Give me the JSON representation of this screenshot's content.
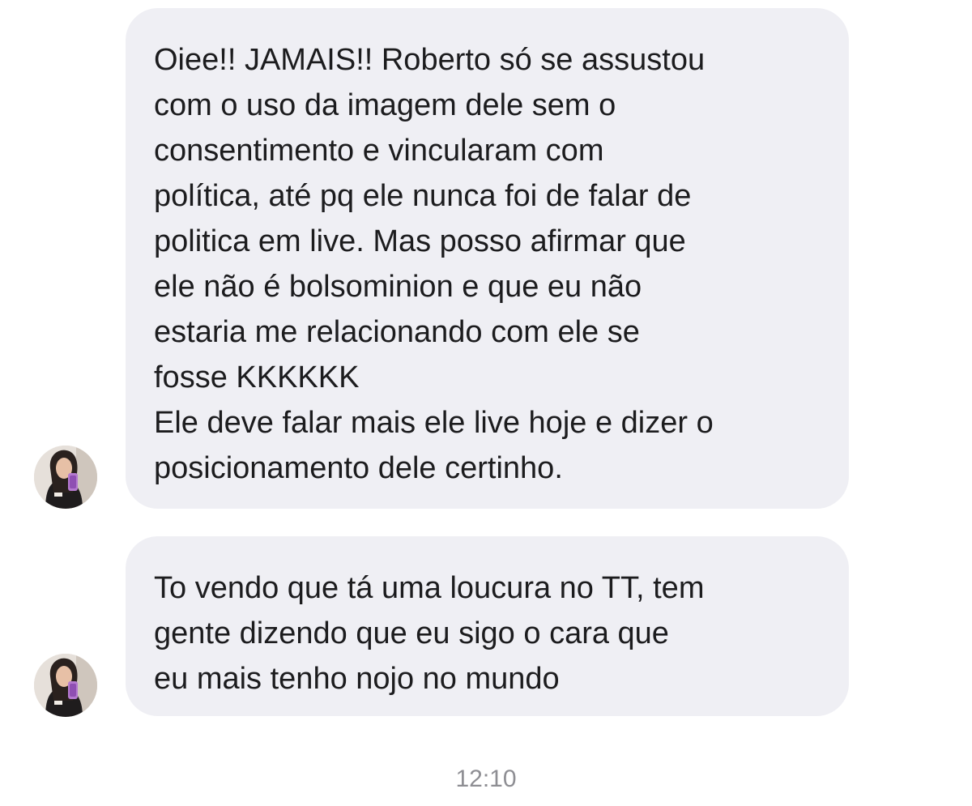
{
  "conversation": {
    "messages": [
      {
        "lines": [
          "Oiee!! JAMAIS!! Roberto só se assustou",
          "com o uso da imagem dele sem o",
          "consentimento e vincularam com",
          "política, até pq ele nunca foi de falar de",
          "politica em live. Mas posso afirmar que",
          "ele não é bolsominion e que eu não",
          "estaria me relacionando com ele se",
          "fosse KKKKKK",
          "Ele deve falar mais ele live hoje e dizer o",
          "posicionamento dele certinho."
        ]
      },
      {
        "lines": [
          "To vendo que tá uma loucura no TT, tem",
          "gente dizendo que eu sigo o cara que",
          "eu mais tenho nojo no mundo"
        ]
      }
    ],
    "timestamp": "12:10"
  },
  "colors": {
    "bubble_background": "#efeff4",
    "text": "#1c1c1e",
    "timestamp": "#8e8e93"
  },
  "icons": {
    "avatar": "user-profile-photo"
  }
}
